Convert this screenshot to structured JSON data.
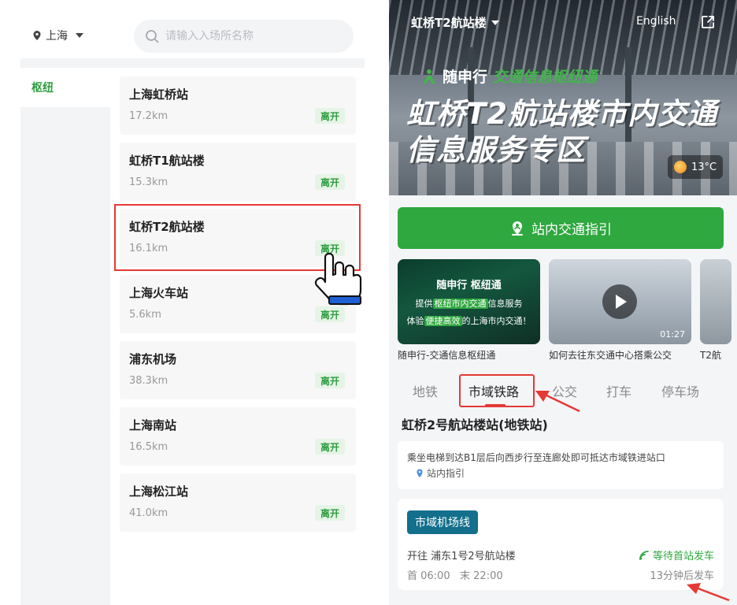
{
  "left": {
    "city": "上海",
    "search_placeholder": "请输入入场所名称",
    "category": "枢纽",
    "stations": [
      {
        "name": "上海虹桥站",
        "distance": "17.2km",
        "action": "离开"
      },
      {
        "name": "虹桥T1航站楼",
        "distance": "15.3km",
        "action": "离开"
      },
      {
        "name": "虹桥T2航站楼",
        "distance": "16.1km",
        "action": "离开"
      },
      {
        "name": "上海火车站",
        "distance": "5.6km",
        "action": "离开"
      },
      {
        "name": "浦东机场",
        "distance": "38.3km",
        "action": "离开"
      },
      {
        "name": "上海南站",
        "distance": "16.5km",
        "action": "离开"
      },
      {
        "name": "上海松江站",
        "distance": "41.0km",
        "action": "离开"
      }
    ]
  },
  "right": {
    "banner": {
      "title": "虹桥T2航站楼",
      "language": "English",
      "brand_main": "随申行",
      "brand_sub": "交通信息枢纽通",
      "headline_1": "虹桥T2航站楼市内交通",
      "headline_2": "信息服务专区",
      "weather": "13°C"
    },
    "guide_button": "站内交通指引",
    "cards": [
      {
        "caption": "随申行-交通信息枢纽通",
        "line1": "随申行 枢纽通",
        "line2_a": "提供",
        "line2_hl": "枢纽市内交通",
        "line2_b": "信息服务",
        "line3_a": "体验",
        "line3_hl": "便捷高效",
        "line3_b": "的上海市内交通！"
      },
      {
        "caption": "如何去往东交通中心搭乘公交",
        "duration": "01:27"
      },
      {
        "caption": "T2航"
      }
    ],
    "tabs": [
      "地铁",
      "市域铁路",
      "公交",
      "打车",
      "停车场"
    ],
    "stop_title": "虹桥2号航站楼站(地铁站)",
    "info": {
      "text": "乘坐电梯到达B1层后向西步行至连廊处即可抵达市域铁进站口",
      "link": "站内指引"
    },
    "line": {
      "name": "市域机场线",
      "direction": "开往 浦东1号2号航站楼",
      "status": "等待首站发车",
      "first": "首 06:00",
      "last": "末 22:00",
      "next": "13分钟后发车"
    },
    "colors": {
      "accent": "#2fa83f",
      "line_badge": "#136f8c",
      "annotation": "#e53935"
    }
  }
}
